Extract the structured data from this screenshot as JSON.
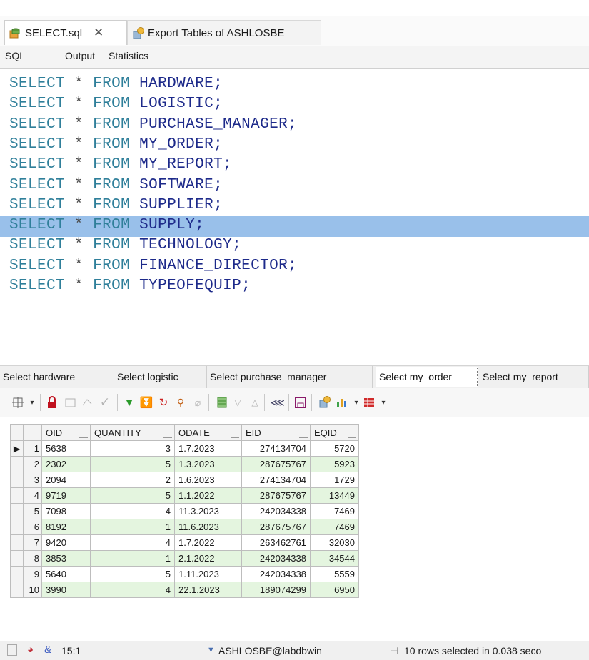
{
  "doc_tabs": [
    {
      "label": "SELECT.sql",
      "icon": "database-file-icon",
      "active": true
    },
    {
      "label": "Export Tables of ASHLOSBE",
      "icon": "export-icon",
      "active": false
    }
  ],
  "close_glyph": "✕",
  "sub_tabs": [
    "SQL",
    "Output",
    "Statistics"
  ],
  "editor": {
    "keyword_select": "SELECT",
    "star": "*",
    "keyword_from": "FROM",
    "lines": [
      "HARDWARE;",
      "LOGISTIC;",
      "PURCHASE_MANAGER;",
      "MY_ORDER;",
      "MY_REPORT;",
      "SOFTWARE;",
      "SUPPLIER;",
      "SUPPLY;",
      "TECHNOLOGY;",
      "FINANCE_DIRECTOR;",
      "TYPEOFEQUIP;"
    ],
    "highlighted_line": 3
  },
  "result_tabs": [
    {
      "label": "Select hardware",
      "active": false
    },
    {
      "label": "Select logistic",
      "active": false
    },
    {
      "label": "Select purchase_manager",
      "active": false
    },
    {
      "label": "Select my_order",
      "active": true
    },
    {
      "label": "Select my_report",
      "active": false
    }
  ],
  "grid": {
    "columns": [
      "OID",
      "QUANTITY",
      "ODATE",
      "EID",
      "EQID"
    ],
    "rows": [
      [
        "1",
        "5638",
        "3",
        "1.7.2023",
        "274134704",
        "5720"
      ],
      [
        "2",
        "2302",
        "5",
        "1.3.2023",
        "287675767",
        "5923"
      ],
      [
        "3",
        "2094",
        "2",
        "1.6.2023",
        "274134704",
        "1729"
      ],
      [
        "4",
        "9719",
        "5",
        "1.1.2022",
        "287675767",
        "13449"
      ],
      [
        "5",
        "7098",
        "4",
        "11.3.2023",
        "242034338",
        "7469"
      ],
      [
        "6",
        "8192",
        "1",
        "11.6.2023",
        "287675767",
        "7469"
      ],
      [
        "7",
        "9420",
        "4",
        "1.7.2022",
        "263462761",
        "32030"
      ],
      [
        "8",
        "3853",
        "1",
        "2.1.2022",
        "242034338",
        "34544"
      ],
      [
        "9",
        "5640",
        "5",
        "1.11.2023",
        "242034338",
        "5559"
      ],
      [
        "10",
        "3990",
        "4",
        "22.1.2023",
        "189074299",
        "6950"
      ]
    ],
    "current_row_marker": "▶"
  },
  "status": {
    "position": "15:1",
    "connection": "ASHLOSBE@labdbwin",
    "message": "10 rows selected in 0.038 seco"
  },
  "colors": {
    "highlight": "#99c0ea",
    "keyword": "#2f7f9a",
    "table_name": "#1d2a8a",
    "even_row": "#e4f5df"
  }
}
